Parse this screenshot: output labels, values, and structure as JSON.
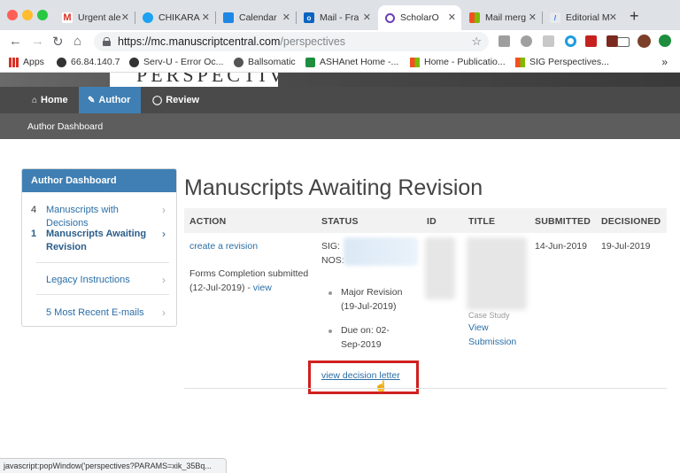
{
  "browser": {
    "tabs": [
      {
        "label": "Urgent ale",
        "icon": "gmail-icon"
      },
      {
        "label": "CHIKARA",
        "icon": "twitter-icon"
      },
      {
        "label": "Calendar",
        "icon": "calendar-icon"
      },
      {
        "label": "Mail - Fra",
        "icon": "outlook-icon"
      },
      {
        "label": "ScholarO",
        "icon": "scholarone-icon"
      },
      {
        "label": "Mail merg",
        "icon": "microsoft-icon"
      },
      {
        "label": "Editorial M",
        "icon": "document-icon"
      }
    ],
    "url_host": "https://mc.manuscriptcentral.com",
    "url_path": "/perspectives",
    "bookmarks": [
      {
        "label": "Apps"
      },
      {
        "label": "66.84.140.7"
      },
      {
        "label": "Serv-U - Error Oc..."
      },
      {
        "label": "Ballsomatic"
      },
      {
        "label": "ASHAnet Home -..."
      },
      {
        "label": "Home - Publicatio..."
      },
      {
        "label": "SIG Perspectives..."
      }
    ],
    "bookmarks_more": "»"
  },
  "site": {
    "logo_text": "PERSPECTIVES",
    "nav": {
      "home": "Home",
      "author": "Author",
      "review": "Review"
    },
    "subnav": "Author Dashboard"
  },
  "sidebar": {
    "header": "Author Dashboard",
    "items": [
      {
        "num": "4",
        "label": "Manuscripts with Decisions"
      },
      {
        "num": "1",
        "label": "Manuscripts Awaiting Revision"
      },
      {
        "num": "",
        "label": "Legacy Instructions"
      },
      {
        "num": "",
        "label": "5 Most Recent E-mails"
      }
    ]
  },
  "main": {
    "title": "Manuscripts Awaiting Revision",
    "columns": [
      "ACTION",
      "STATUS",
      "ID",
      "TITLE",
      "SUBMITTED",
      "DECISIONED"
    ],
    "row": {
      "action_link": "create a revision",
      "forms_text": "Forms Completion submitted (12-Jul-2019) - ",
      "forms_link": "view",
      "sig": "SIG: ",
      "nos": "NOS: ",
      "status_major": "Major Revision (19-Jul-2019)",
      "status_due": "Due on: 02-Sep-2019",
      "title_partial": "Case Study",
      "view_submission": "View Submission",
      "submitted": "14-Jun-2019",
      "decisioned": "19-Jul-2019",
      "decision_link": "view decision letter"
    }
  },
  "statusbar": "javascript:popWindow('perspectives?PARAMS=xik_35Bq..."
}
